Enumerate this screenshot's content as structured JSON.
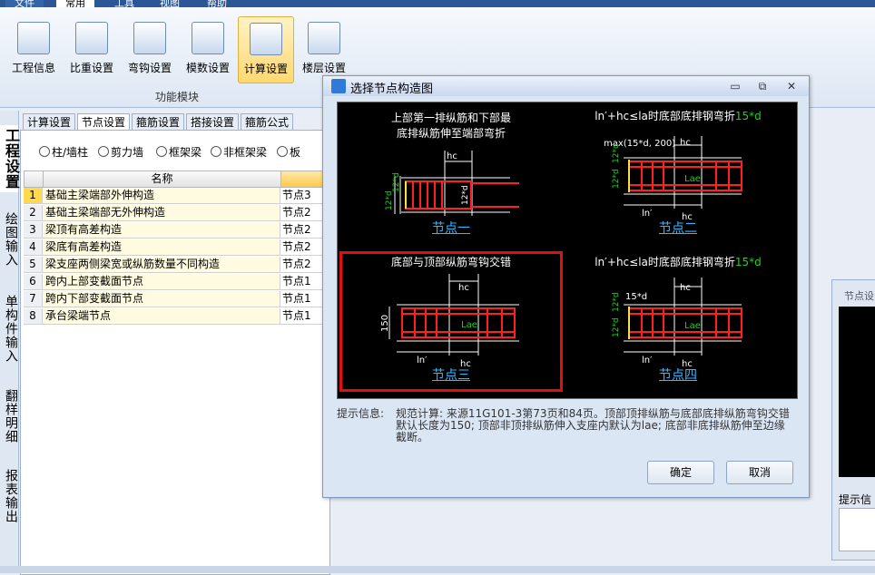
{
  "menu": {
    "tabs": [
      "文件",
      "常用",
      "工具",
      "视图",
      "帮助"
    ]
  },
  "ribbon": {
    "buttons": [
      "工程信息",
      "比重设置",
      "弯钩设置",
      "模数设置",
      "计算设置",
      "楼层设置"
    ],
    "group_label": "功能模块"
  },
  "side_tabs": [
    "工程设置",
    "绘图输入",
    "单构件输入",
    "翻样明细",
    "报表输出"
  ],
  "sub_tabs": [
    "计算设置",
    "节点设置",
    "箍筋设置",
    "搭接设置",
    "箍筋公式"
  ],
  "radios": [
    "柱/墙柱",
    "剪力墙",
    "框架梁",
    "非框架梁",
    "板"
  ],
  "table": {
    "header_name": "名称",
    "rows": [
      {
        "n": "1",
        "name": "基础主梁端部外伸构造",
        "val": "节点3"
      },
      {
        "n": "2",
        "name": "基础主梁端部无外伸构造",
        "val": "节点2"
      },
      {
        "n": "3",
        "name": "梁顶有高差构造",
        "val": "节点2"
      },
      {
        "n": "4",
        "name": "梁底有高差构造",
        "val": "节点2"
      },
      {
        "n": "5",
        "name": "梁支座两侧梁宽或纵筋数量不同构造",
        "val": "节点2"
      },
      {
        "n": "6",
        "name": "跨内上部变截面节点",
        "val": "节点1"
      },
      {
        "n": "7",
        "name": "跨内下部变截面节点",
        "val": "节点1"
      },
      {
        "n": "8",
        "name": "承台梁端节点",
        "val": "节点1"
      }
    ]
  },
  "right_panel": {
    "title": "节点设",
    "hint": "提示信"
  },
  "dialog": {
    "title": "选择节点构造图",
    "window_buttons": {
      "minimize": "▭",
      "restore": "⧉",
      "close": "✕"
    },
    "panels": [
      {
        "caption1": "上部第一排纵筋和下部最",
        "caption2": "底排纵筋伸至端部弯折",
        "green": "",
        "label": "节点一",
        "dims": {
          "hc": "hc",
          "a": "12*d",
          "b": "12*d",
          "c": "12*d"
        }
      },
      {
        "caption1": "ln′+hc≤la时底部底排钢弯折",
        "caption2": "",
        "green": "15*d",
        "label": "节点二",
        "dims": {
          "max": "max(15*d, 200)",
          "hc": "hc",
          "a": "12*d",
          "b": "12*d",
          "lae": "Lae",
          "ln": "ln′",
          "hc2": "hc"
        }
      },
      {
        "caption1": "底部与顶部纵筋弯钩交错",
        "caption2": "",
        "green": "",
        "label": "节点三",
        "dims": {
          "hc": "hc",
          "v150": "150",
          "lae": "Lae",
          "ln": "ln′",
          "hc2": "hc"
        }
      },
      {
        "caption1": "ln′+hc≤la时底部底排钢弯折",
        "caption2": "",
        "green": "15*d",
        "label": "节点四",
        "dims": {
          "d15": "15*d",
          "hc": "hc",
          "a": "12*d",
          "b": "12*d",
          "lae": "Lae",
          "ln": "ln′",
          "hc2": "hc"
        }
      }
    ],
    "hint_label": "提示信息:",
    "hint_text": "规范计算: 来源11G101-3第73页和84页。顶部顶排纵筋与底部底排纵筋弯钩交错默认长度为150; 顶部非顶排纵筋伸入支座内默认为lae; 底部非底排纵筋伸至边缘截断。",
    "ok": "确定",
    "cancel": "取消"
  },
  "colors": {
    "selected_border": "#e01010",
    "rebar": "#ff2020",
    "label": "#32b8ff",
    "accent_green": "#20d020"
  }
}
